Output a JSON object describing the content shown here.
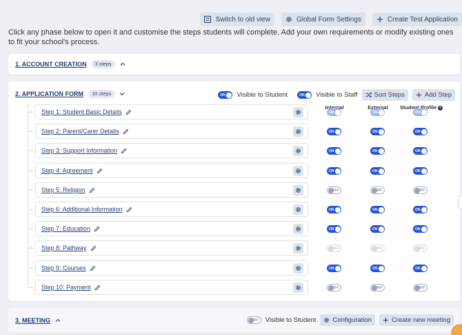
{
  "toolbar": {
    "switch_label": "Switch to old view",
    "global_label": "Global Form Settings",
    "create_label": "Create Test Application"
  },
  "intro": "Click any phase below to open it and customise the steps students will complete. Add your own requirements or modify existing ones to fit your school's process.",
  "phases": [
    {
      "title": "1. ACCOUNT CREATION",
      "badge": "3 steps"
    },
    {
      "title": "2. APPLICATION FORM",
      "badge": "10 steps",
      "visible_student_label": "Visible to Student",
      "visible_staff_label": "Visible to Staff",
      "visible_student": "on",
      "visible_staff": "on",
      "sort_label": "Sort Steps",
      "add_label": "Add Step",
      "columns": [
        "Internal",
        "External",
        "Student Profile"
      ],
      "steps": [
        {
          "label": "Step 1: Student Basic Details",
          "internal": "disabled-on",
          "external": "disabled-on",
          "profile": "disabled-on"
        },
        {
          "label": "Step 2: Parent/Carer Details",
          "internal": "on",
          "external": "on",
          "profile": "on"
        },
        {
          "label": "Step 3: Support Information",
          "internal": "on",
          "external": "on",
          "profile": "on"
        },
        {
          "label": "Step 4: Agreement",
          "internal": "on",
          "external": "on",
          "profile": "on"
        },
        {
          "label": "Step 5: Religion",
          "internal": "off",
          "external": "off",
          "profile": "off"
        },
        {
          "label": "Step 6: Additional Information",
          "internal": "on",
          "external": "on",
          "profile": "on"
        },
        {
          "label": "Step 7: Education",
          "internal": "on",
          "external": "on",
          "profile": "on"
        },
        {
          "label": "Step 8: Pathway",
          "internal": "disabled-off",
          "external": "disabled-off",
          "profile": "disabled-off"
        },
        {
          "label": "Step 9: Courses",
          "internal": "on",
          "external": "on",
          "profile": "on"
        },
        {
          "label": "Step 10: Payment",
          "internal": "off",
          "external": "off",
          "profile": "off"
        }
      ]
    },
    {
      "title": "3. MEETING",
      "visible_student_label": "Visible to Student",
      "visible_student": "off",
      "config_label": "Configuration",
      "create_meeting_label": "Create new meeting"
    }
  ],
  "toggle_text": {
    "on": "ON",
    "off": "OFF"
  },
  "colors": {
    "accent": "#2455d8",
    "title": "#1f3a74",
    "button_bg": "#dde3ed",
    "page_bg": "#eef0f5"
  },
  "icons": [
    "list-icon",
    "gear-icon",
    "plus-icon",
    "chevron-up-icon",
    "chevron-down-icon",
    "shuffle-icon",
    "pencil-icon",
    "info-icon"
  ]
}
